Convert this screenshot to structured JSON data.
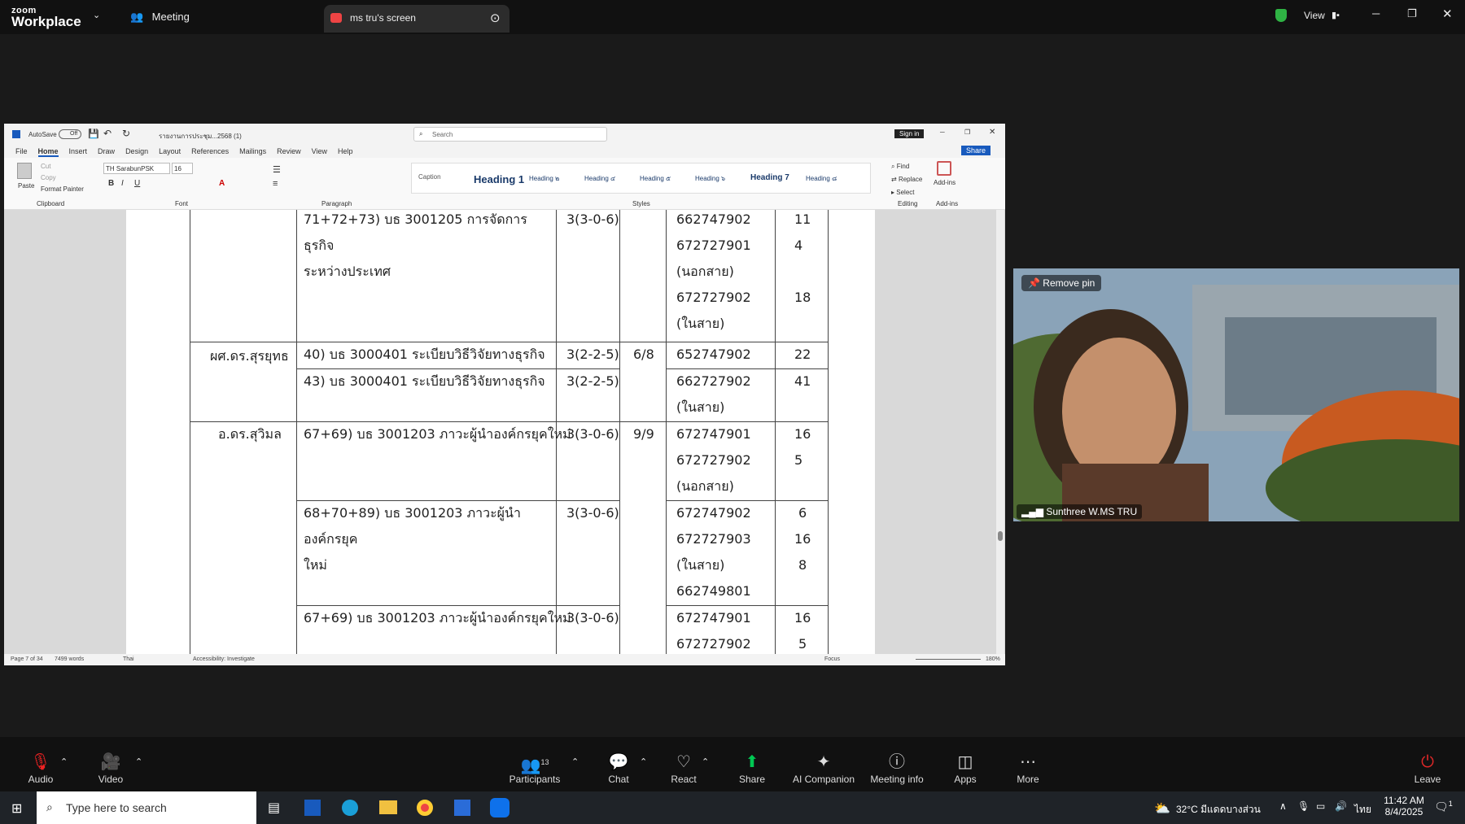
{
  "zoom": {
    "logo_top": "zoom",
    "logo_bottom": "Workplace",
    "meeting_label": "Meeting",
    "share_tab_label": "ms tru's screen",
    "view_label": "View"
  },
  "word": {
    "autosave_label": "AutoSave",
    "autosave_state": "Off",
    "doc_name": "รายงานการประชุม...2568 (1)",
    "search_placeholder": "Search",
    "signin_label": "Sign in",
    "menu": [
      "File",
      "Home",
      "Insert",
      "Draw",
      "Design",
      "Layout",
      "References",
      "Mailings",
      "Review",
      "View",
      "Help"
    ],
    "share_label": "Share",
    "font_name": "TH SarabunPSK",
    "font_size": "16",
    "clipboard": {
      "paste": "Paste",
      "cut": "Cut",
      "copy": "Copy",
      "format_painter": "Format Painter",
      "group": "Clipboard"
    },
    "groups": {
      "font": "Font",
      "paragraph": "Paragraph",
      "styles": "Styles",
      "editing": "Editing",
      "addins": "Add-ins"
    },
    "styles": [
      "Caption",
      "Heading 1",
      "Heading ๒",
      "Heading ๔",
      "Heading ๕",
      "Heading ๖",
      "Heading 7",
      "Heading ๘"
    ],
    "editing": {
      "find": "Find",
      "replace": "Replace",
      "select": "Select"
    },
    "addins_label": "Add-ins",
    "status": {
      "page": "Page 7 of 34",
      "words": "7499 words",
      "lang": "Thai",
      "accessibility": "Accessibility: Investigate",
      "focus": "Focus",
      "zoom": "180%"
    }
  },
  "table": {
    "rows": [
      {
        "course": "71+72+73) บธ 3001205 การจัดการธุรกิจ",
        "course2": "ระหว่างประเทศ",
        "credit": "3(3-0-6)",
        "codes": [
          "662747902",
          "672727901",
          "(นอกสาย)",
          "672727902",
          "(ในสาย)"
        ],
        "counts": [
          "11",
          "4",
          "18"
        ]
      },
      {
        "teacher": "ผศ.ดร.สุรยุทธ",
        "course": "40) บธ 3000401 ระเบียบวิธีวิจัยทางธุรกิจ",
        "credit": "3(2-2-5)",
        "load": "6/8",
        "codes": [
          "652747902"
        ],
        "counts": [
          "22"
        ]
      },
      {
        "course": "43) บธ 3000401 ระเบียบวิธีวิจัยทางธุรกิจ",
        "credit": "3(2-2-5)",
        "codes": [
          "662727902",
          "(ในสาย)"
        ],
        "counts": [
          "41"
        ]
      },
      {
        "teacher": "อ.ดร.สุวิมล",
        "course": "67+69) บธ 3001203 ภาวะผู้นำองค์กรยุคใหม่",
        "credit": "3(3-0-6)",
        "load": "9/9",
        "codes": [
          "672747901",
          "672727902",
          "(นอกสาย)"
        ],
        "counts": [
          "16",
          "5"
        ]
      },
      {
        "course": "68+70+89) บธ 3001203 ภาวะผู้นำองค์กรยุค",
        "course2": "ใหม่",
        "credit": "3(3-0-6)",
        "codes": [
          "672747902",
          "672727903",
          "(ในสาย)",
          "662749801"
        ],
        "counts": [
          "6",
          "16",
          "8"
        ]
      },
      {
        "course": "67+69) บธ 3001203 ภาวะผู้นำองค์กรยุคใหม่",
        "credit": "3(3-0-6)",
        "codes": [
          "672747901",
          "672727902"
        ],
        "counts": [
          "16",
          "5"
        ]
      }
    ]
  },
  "video": {
    "remove_pin": "Remove pin",
    "participant": "Sunthree W.MS TRU"
  },
  "toolbar": {
    "audio": "Audio",
    "video": "Video",
    "participants": "Participants",
    "participants_count": "13",
    "chat": "Chat",
    "react": "React",
    "share": "Share",
    "ai": "AI Companion",
    "info": "Meeting info",
    "apps": "Apps",
    "more": "More",
    "leave": "Leave"
  },
  "taskbar": {
    "search_placeholder": "Type here to search",
    "weather": "32°C มีแดดบางส่วน",
    "lang": "ไทย",
    "time": "11:42 AM",
    "date": "8/4/2025",
    "notifications": "1"
  },
  "colors": {
    "accent": "#0e71eb",
    "share_green": "#00c853",
    "leave_red": "#e02828"
  }
}
